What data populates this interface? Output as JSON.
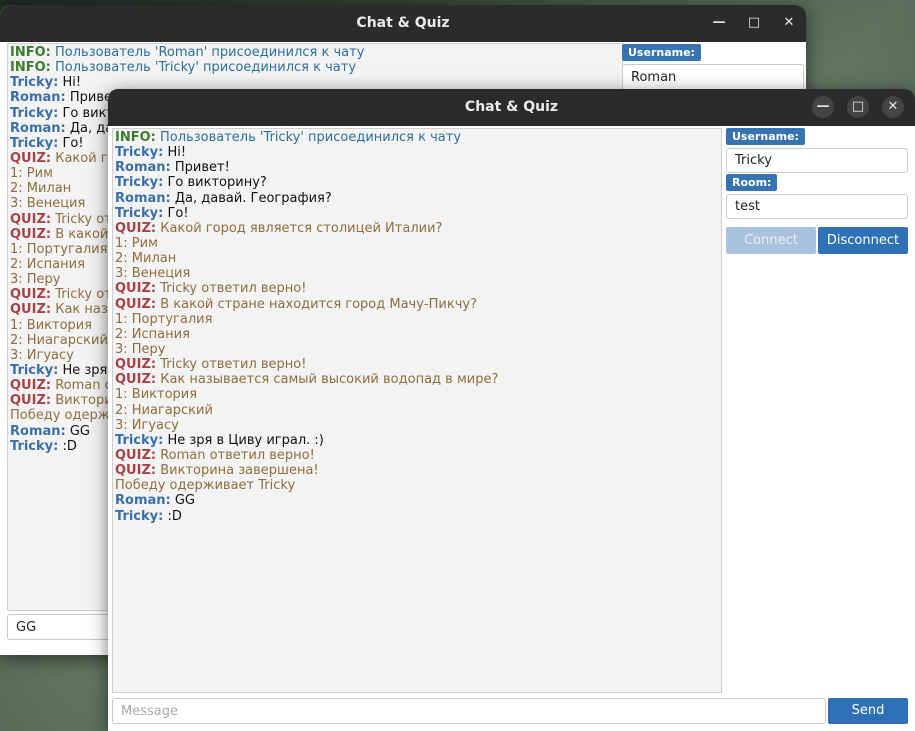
{
  "back_window": {
    "title": "Chat & Quiz",
    "username_label": "Username:",
    "username_value": "Roman",
    "message_value": "GG",
    "messages": [
      {
        "sender": "INFO:",
        "text": "Пользователь 'Roman' присоединился к чату",
        "kind": "info"
      },
      {
        "sender": "INFO:",
        "text": "Пользователь 'Tricky' присоединился к чату",
        "kind": "info"
      },
      {
        "sender": "Tricky:",
        "text": "Hi!",
        "kind": "user"
      },
      {
        "sender": "Roman:",
        "text": "Приве",
        "kind": "user"
      },
      {
        "sender": "Tricky:",
        "text": "Го викт",
        "kind": "user"
      },
      {
        "sender": "Roman:",
        "text": "Да, да",
        "kind": "user"
      },
      {
        "sender": "Tricky:",
        "text": "Го!",
        "kind": "user"
      },
      {
        "sender": "QUIZ:",
        "text": "Какой го",
        "kind": "quiz"
      },
      {
        "sender": "",
        "text": "1: Рим",
        "kind": "sys"
      },
      {
        "sender": "",
        "text": "2: Милан",
        "kind": "sys"
      },
      {
        "sender": "",
        "text": "3: Венеция",
        "kind": "sys"
      },
      {
        "sender": "QUIZ:",
        "text": "Tricky от",
        "kind": "quiz"
      },
      {
        "sender": "QUIZ:",
        "text": "В какой",
        "kind": "quiz"
      },
      {
        "sender": "",
        "text": "1: Португалия",
        "kind": "sys"
      },
      {
        "sender": "",
        "text": "2: Испания",
        "kind": "sys"
      },
      {
        "sender": "",
        "text": "3: Перу",
        "kind": "sys"
      },
      {
        "sender": "QUIZ:",
        "text": "Tricky от",
        "kind": "quiz"
      },
      {
        "sender": "QUIZ:",
        "text": "Как наз",
        "kind": "quiz"
      },
      {
        "sender": "",
        "text": "1: Виктория",
        "kind": "sys"
      },
      {
        "sender": "",
        "text": "2: Ниагарский",
        "kind": "sys"
      },
      {
        "sender": "",
        "text": "3: Игуасу",
        "kind": "sys"
      },
      {
        "sender": "Tricky:",
        "text": "Не зря",
        "kind": "user"
      },
      {
        "sender": "QUIZ:",
        "text": "Roman о",
        "kind": "quiz"
      },
      {
        "sender": "QUIZ:",
        "text": "Виктори",
        "kind": "quiz"
      },
      {
        "sender": "",
        "text": "Победу одерж",
        "kind": "sys"
      },
      {
        "sender": "Roman:",
        "text": "GG",
        "kind": "user"
      },
      {
        "sender": "Tricky:",
        "text": ":D",
        "kind": "user"
      }
    ]
  },
  "front_window": {
    "title": "Chat & Quiz",
    "username_label": "Username:",
    "username_value": "Tricky",
    "room_label": "Room:",
    "room_value": "test",
    "connect_label": "Connect",
    "disconnect_label": "Disconnect",
    "message_placeholder": "Message",
    "send_label": "Send",
    "messages": [
      {
        "sender": "INFO:",
        "text": "Пользователь 'Tricky' присоединился к чату",
        "kind": "info"
      },
      {
        "sender": "Tricky:",
        "text": "Hi!",
        "kind": "user"
      },
      {
        "sender": "Roman:",
        "text": "Привет!",
        "kind": "user"
      },
      {
        "sender": "Tricky:",
        "text": "Го викторину?",
        "kind": "user"
      },
      {
        "sender": "Roman:",
        "text": "Да, давай. География?",
        "kind": "user"
      },
      {
        "sender": "Tricky:",
        "text": "Го!",
        "kind": "user"
      },
      {
        "sender": "QUIZ:",
        "text": "Какой город является столицей Италии?",
        "kind": "quiz"
      },
      {
        "sender": "",
        "text": "1: Рим",
        "kind": "sys"
      },
      {
        "sender": "",
        "text": "2: Милан",
        "kind": "sys"
      },
      {
        "sender": "",
        "text": "3: Венеция",
        "kind": "sys"
      },
      {
        "sender": "QUIZ:",
        "text": "Tricky ответил верно!",
        "kind": "quiz"
      },
      {
        "sender": "QUIZ:",
        "text": "В какой стране находится город Мачу-Пикчу?",
        "kind": "quiz"
      },
      {
        "sender": "",
        "text": "1: Португалия",
        "kind": "sys"
      },
      {
        "sender": "",
        "text": "2: Испания",
        "kind": "sys"
      },
      {
        "sender": "",
        "text": "3: Перу",
        "kind": "sys"
      },
      {
        "sender": "QUIZ:",
        "text": "Tricky ответил верно!",
        "kind": "quiz"
      },
      {
        "sender": "QUIZ:",
        "text": "Как называется самый высокий водопад в мире?",
        "kind": "quiz"
      },
      {
        "sender": "",
        "text": "1: Виктория",
        "kind": "sys"
      },
      {
        "sender": "",
        "text": "2: Ниагарский",
        "kind": "sys"
      },
      {
        "sender": "",
        "text": "3: Игуасу",
        "kind": "sys"
      },
      {
        "sender": "Tricky:",
        "text": "Не зря в Циву играл. :)",
        "kind": "user"
      },
      {
        "sender": "QUIZ:",
        "text": "Roman ответил верно!",
        "kind": "quiz"
      },
      {
        "sender": "QUIZ:",
        "text": "Викторина завершена!",
        "kind": "quiz"
      },
      {
        "sender": "",
        "text": "Победу одерживает Tricky",
        "kind": "sys"
      },
      {
        "sender": "Roman:",
        "text": "GG",
        "kind": "user"
      },
      {
        "sender": "Tricky:",
        "text": ":D",
        "kind": "user"
      }
    ]
  }
}
